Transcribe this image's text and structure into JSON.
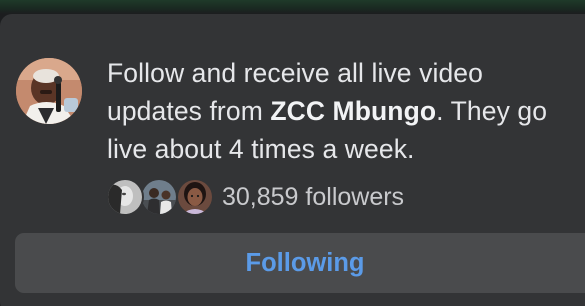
{
  "post": {
    "message": {
      "before": "Follow and receive all live video updates from ",
      "page_name": "ZCC Mbungo",
      "after": ". They go live about 4 times a week."
    },
    "followers_text": "30,859 followers",
    "follower_avatars": [
      "follower-avatar-1",
      "follower-avatar-2",
      "follower-avatar-3"
    ],
    "button_label": "Following"
  },
  "colors": {
    "card_background": "#333436",
    "button_background": "#4a4b4d",
    "button_text": "#5b9be8",
    "primary_text": "#e6e7ea",
    "secondary_text": "#c9cacd"
  }
}
